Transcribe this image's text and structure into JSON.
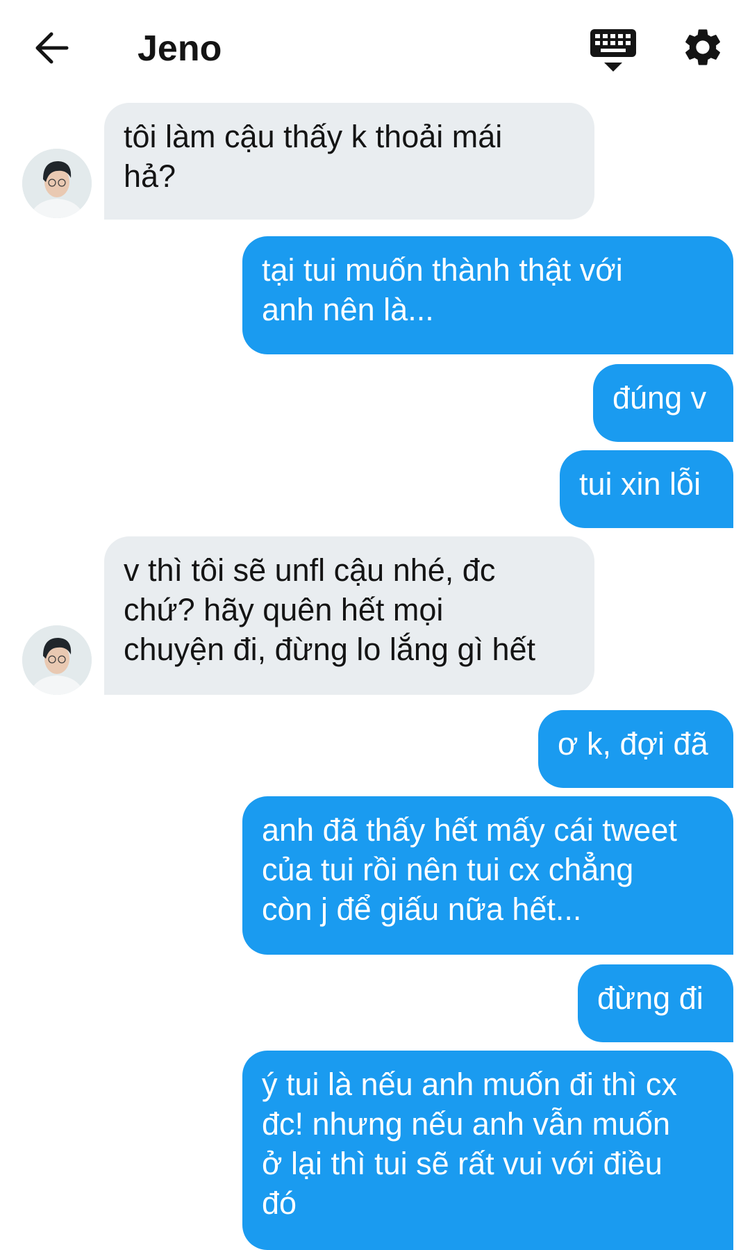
{
  "header": {
    "title": "Jeno",
    "back_icon": "arrow-left-icon",
    "keyboard_icon": "keyboard-icon",
    "settings_icon": "gear-icon"
  },
  "colors": {
    "outgoing_bubble": "#1a9bf0",
    "incoming_bubble": "#e9edf0",
    "text": "#141414"
  },
  "messages": [
    {
      "direction": "in",
      "lines": [
        "tôi làm cậu thấy k thoải mái",
        "hả?"
      ]
    },
    {
      "direction": "out",
      "lines": [
        "tại tui muốn thành thật với",
        "anh nên là..."
      ]
    },
    {
      "direction": "out",
      "lines": [
        "đúng v"
      ]
    },
    {
      "direction": "out",
      "lines": [
        "tui xin lỗi"
      ]
    },
    {
      "direction": "in",
      "lines": [
        "v thì tôi sẽ unfl cậu nhé, đc",
        "chứ? hãy quên hết mọi",
        "chuyện đi, đừng lo lắng gì hết"
      ]
    },
    {
      "direction": "out",
      "lines": [
        "ơ k, đợi đã"
      ]
    },
    {
      "direction": "out",
      "lines": [
        "anh đã thấy hết mấy cái tweet",
        "của tui rồi nên tui cx chẳng",
        "còn j để giấu nữa hết..."
      ]
    },
    {
      "direction": "out",
      "lines": [
        "đừng đi"
      ]
    },
    {
      "direction": "out",
      "lines": [
        "ý tui là nếu anh muốn đi thì cx",
        "đc! nhưng nếu anh vẫn muốn",
        "ở lại thì tui sẽ rất vui với điều",
        "đó"
      ]
    }
  ]
}
